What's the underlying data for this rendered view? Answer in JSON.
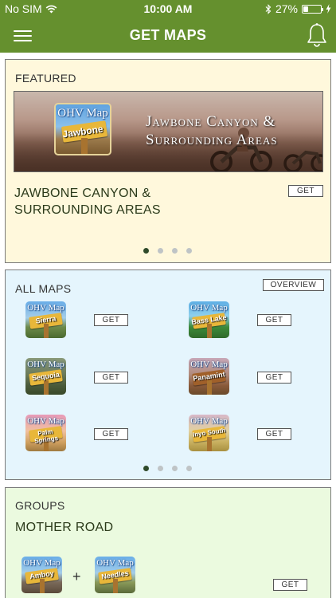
{
  "status": {
    "carrier": "No SIM",
    "time": "10:00 AM",
    "battery": "27%",
    "battery_level": 0.27
  },
  "nav": {
    "title": "GET MAPS"
  },
  "featured": {
    "title": "FEATURED",
    "banner_icon_header": "OHV Map",
    "banner_icon_label": "Jawbone",
    "banner_text": "Jawbone Canyon & Surrounding Areas",
    "name": "JAWBONE CANYON & SURROUNDING AREAS",
    "get_label": "GET",
    "pager_pages": 4,
    "pager_active": 0
  },
  "all_maps": {
    "title": "ALL MAPS",
    "overview_label": "OVERVIEW",
    "pager_pages": 4,
    "pager_active": 0,
    "items": [
      {
        "header": "OHV Map",
        "label": "Sierra",
        "get_label": "GET"
      },
      {
        "header": "OHV Map",
        "label": "Bass Lake",
        "get_label": "GET"
      },
      {
        "header": "OHV Map",
        "label": "Sequoia",
        "get_label": "GET"
      },
      {
        "header": "OHV Map",
        "label": "Panamint",
        "get_label": "GET"
      },
      {
        "header": "OHV Map",
        "label": "Palm Springs",
        "get_label": "GET"
      },
      {
        "header": "OHV Map",
        "label": "Inyo South",
        "get_label": "GET"
      }
    ]
  },
  "groups": {
    "title": "GROUPS",
    "name": "MOTHER ROAD",
    "plus": "+",
    "get_label": "GET",
    "items": [
      {
        "header": "OHV Map",
        "label": "Amboy"
      },
      {
        "header": "OHV Map",
        "label": "Needles"
      }
    ]
  },
  "colors": {
    "brand_green": "#65902e",
    "featured_bg": "#fff8dc",
    "allmaps_bg": "#e5f5fd",
    "groups_bg": "#ebfadf"
  }
}
